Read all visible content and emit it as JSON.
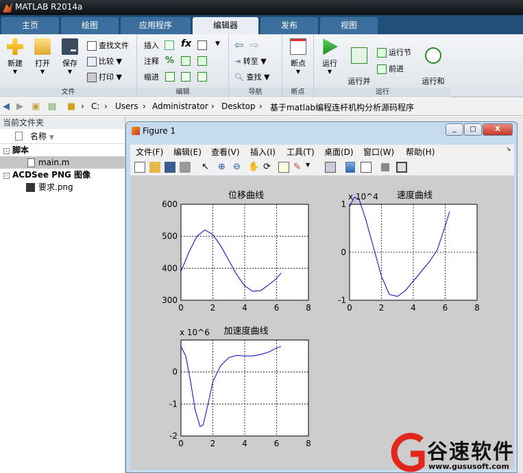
{
  "app": {
    "title": "MATLAB R2014a"
  },
  "tabs": [
    {
      "label": "主页"
    },
    {
      "label": "绘图"
    },
    {
      "label": "应用程序"
    },
    {
      "label": "编辑器"
    },
    {
      "label": "发布"
    },
    {
      "label": "视图"
    }
  ],
  "ribbon": {
    "file": {
      "group": "文件",
      "new": "新建",
      "open": "打开",
      "save": "保存",
      "find_files": "查找文件",
      "compare": "比较",
      "print": "打印"
    },
    "edit": {
      "group": "编辑",
      "insert": "插入",
      "comment": "注释",
      "indent": "缩进",
      "fx": "fx"
    },
    "nav": {
      "group": "导航",
      "goto": "转至",
      "find": "查找"
    },
    "breakpoints": {
      "group": "断点",
      "label": "断点"
    },
    "run": {
      "group": "运行",
      "run": "运行",
      "run_advance": "运行并\n前进",
      "run_section": "运行节",
      "advance": "前进",
      "run_time": "运行和\n计时"
    }
  },
  "path": {
    "crumbs": [
      "C:",
      "Users",
      "Administrator",
      "Desktop",
      "基于matlab编程连杆机构分析源码程序"
    ]
  },
  "filebrowser": {
    "title": "当前文件夹",
    "column": "名称",
    "groups": [
      {
        "name": "脚本",
        "files": [
          "main.m"
        ]
      },
      {
        "name": "ACDSee PNG 图像",
        "files": [
          "要求.png"
        ]
      }
    ]
  },
  "figure": {
    "title": "Figure 1",
    "menu": [
      "文件(F)",
      "编辑(E)",
      "查看(V)",
      "插入(I)",
      "工具(T)",
      "桌面(D)",
      "窗口(W)",
      "帮助(H)"
    ],
    "min": "_",
    "max": "□",
    "close": "X"
  },
  "chart_data": [
    {
      "type": "line",
      "title": "位移曲线",
      "xlim": [
        0,
        8
      ],
      "ylim": [
        300,
        600
      ],
      "xticks": [
        "0",
        "2",
        "4",
        "6",
        "8"
      ],
      "yticks": [
        "300",
        "400",
        "500",
        "600"
      ],
      "grid": true,
      "exponent": "",
      "x": [
        0,
        0.5,
        1,
        1.5,
        2,
        2.5,
        3,
        3.5,
        4,
        4.5,
        5,
        5.5,
        6,
        6.28
      ],
      "y": [
        390,
        450,
        500,
        520,
        505,
        470,
        425,
        380,
        345,
        328,
        330,
        348,
        368,
        385
      ]
    },
    {
      "type": "line",
      "title": "速度曲线",
      "xlim": [
        0,
        8
      ],
      "ylim": [
        -1,
        1
      ],
      "xticks": [
        "0",
        "2",
        "4",
        "6",
        "8"
      ],
      "yticks": [
        "-1",
        "0",
        "1"
      ],
      "grid": true,
      "exponent": "x 10^4",
      "x": [
        0,
        0.3,
        0.6,
        1,
        1.5,
        2,
        2.5,
        3,
        3.5,
        4,
        4.5,
        5,
        5.5,
        6,
        6.28
      ],
      "y": [
        0.95,
        1.15,
        1.1,
        0.7,
        0.1,
        -0.5,
        -0.88,
        -0.92,
        -0.8,
        -0.6,
        -0.4,
        -0.2,
        0.05,
        0.55,
        0.85
      ]
    },
    {
      "type": "line",
      "title": "加速度曲线",
      "xlim": [
        0,
        8
      ],
      "ylim": [
        -2,
        1
      ],
      "xticks": [
        "0",
        "2",
        "4",
        "6",
        "8"
      ],
      "yticks": [
        "-2",
        "-1",
        "0"
      ],
      "grid": true,
      "exponent": "x 10^6",
      "x": [
        0,
        0.3,
        0.6,
        0.9,
        1.2,
        1.4,
        1.7,
        2,
        2.5,
        3,
        3.5,
        4,
        4.5,
        5,
        5.5,
        6,
        6.28
      ],
      "y": [
        0.8,
        0.5,
        -0.3,
        -1.2,
        -1.7,
        -1.65,
        -1.0,
        -0.3,
        0.2,
        0.45,
        0.52,
        0.5,
        0.5,
        0.55,
        0.62,
        0.75,
        0.8
      ]
    }
  ],
  "watermark": {
    "brand": "谷速软件",
    "url": "www.gususoft.com"
  }
}
